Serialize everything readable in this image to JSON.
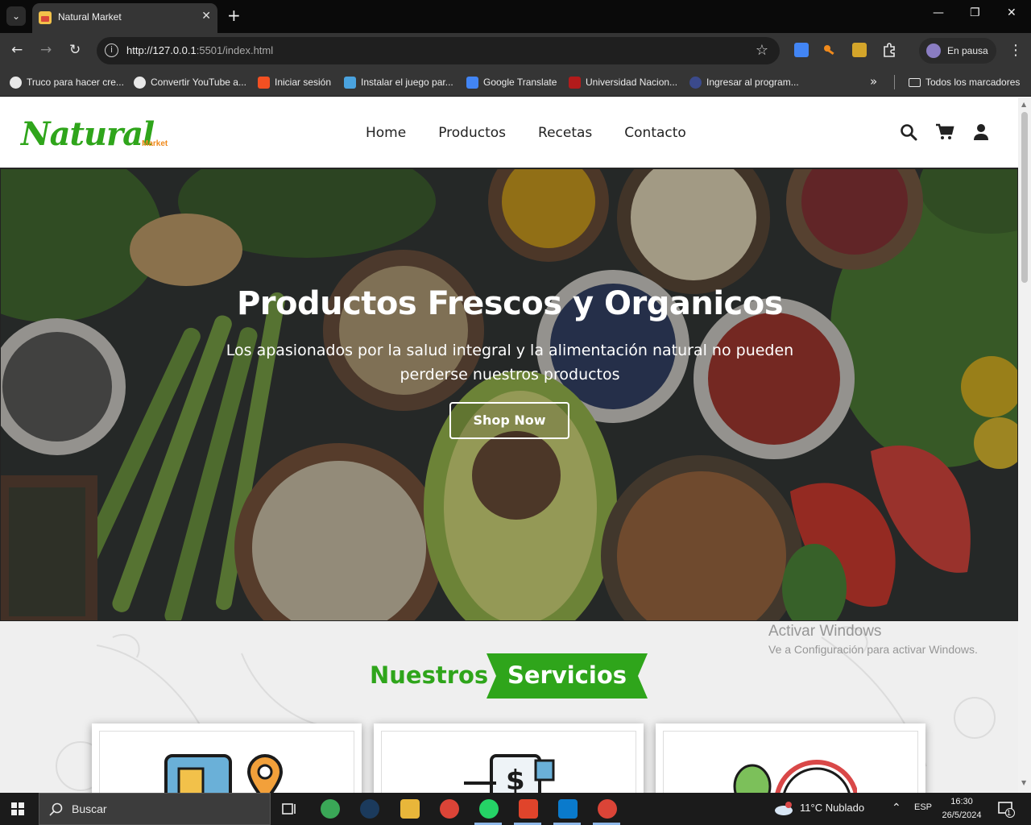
{
  "browser": {
    "tab_title": "Natural Market",
    "tab_close": "✕",
    "new_tab": "+",
    "url_host": "http://127.0.0.1",
    "url_rest": ":5501/index.html",
    "profile_label": "En pausa",
    "bookmarks": [
      {
        "label": "Truco para hacer cre...",
        "icon_color": "#e8e8e8"
      },
      {
        "label": "Convertir YouTube a...",
        "icon_color": "#e8e8e8"
      },
      {
        "label": "Iniciar sesión",
        "icon_color": "#f25022"
      },
      {
        "label": "Instalar el juego par...",
        "icon_color": "#4aa3df"
      },
      {
        "label": "Google Translate",
        "icon_color": "#4285f4"
      },
      {
        "label": "Universidad Nacion...",
        "icon_color": "#b31b1b"
      },
      {
        "label": "Ingresar al program...",
        "icon_color": "#3b4a8c"
      }
    ],
    "bookmarks_more": "»",
    "all_bookmarks": "Todos los marcadores"
  },
  "site": {
    "logo": "Natural",
    "logo_sub": "Market",
    "nav": [
      "Home",
      "Productos",
      "Recetas",
      "Contacto"
    ],
    "hero": {
      "title": "Productos Frescos y Organicos",
      "text": "Los apasionados por la salud integral y la alimentación natural no pueden perderse nuestros productos",
      "button": "Shop Now"
    },
    "services": {
      "title_a": "Nuestros",
      "title_b": "Servicios"
    }
  },
  "windows_watermark": {
    "line1": "Activar Windows",
    "line2": "Ve a Configuración para activar Windows."
  },
  "taskbar": {
    "search_placeholder": "Buscar",
    "weather": "11°C  Nublado",
    "language": "ESP",
    "time": "16:30",
    "date": "26/5/2024",
    "notifications": "1"
  },
  "colors": {
    "brand_green": "#2fa51b",
    "brand_orange": "#f08a1c"
  }
}
